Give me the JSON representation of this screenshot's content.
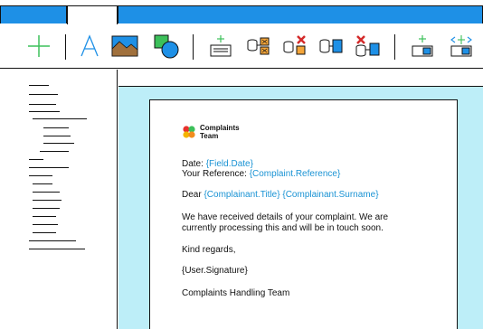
{
  "logo": {
    "line1": "Complaints",
    "line2": "Team"
  },
  "letter": {
    "date_label": "Date: ",
    "date_field": "{Field.Date}",
    "ref_label": "Your Reference: ",
    "ref_field": "{Complaint.Reference}",
    "dear_label": "Dear ",
    "title_field": "{Complainant.Title}",
    "surname_field": "{Complainant.Surname}",
    "body_line1": "We have received details of your complaint. We are",
    "body_line2": "currently processing this and will be in touch soon.",
    "closing": "Kind regards,",
    "signature_field": "{User.Signature}",
    "team_name": "Complaints Handling Team"
  },
  "toolbar": {
    "icons": [
      "add-icon",
      "text-icon",
      "image-icon",
      "shapes-icon",
      "insert-field-icon",
      "db-link-icon",
      "db-unlink-icon",
      "db-table-icon",
      "db-remove-icon",
      "add-section-icon",
      "expand-section-icon"
    ]
  },
  "colors": {
    "accent_blue": "#1e90e6",
    "canvas_bg": "#bdeef8",
    "field_text": "#1a93d4",
    "plus_green": "#3cc05a"
  }
}
